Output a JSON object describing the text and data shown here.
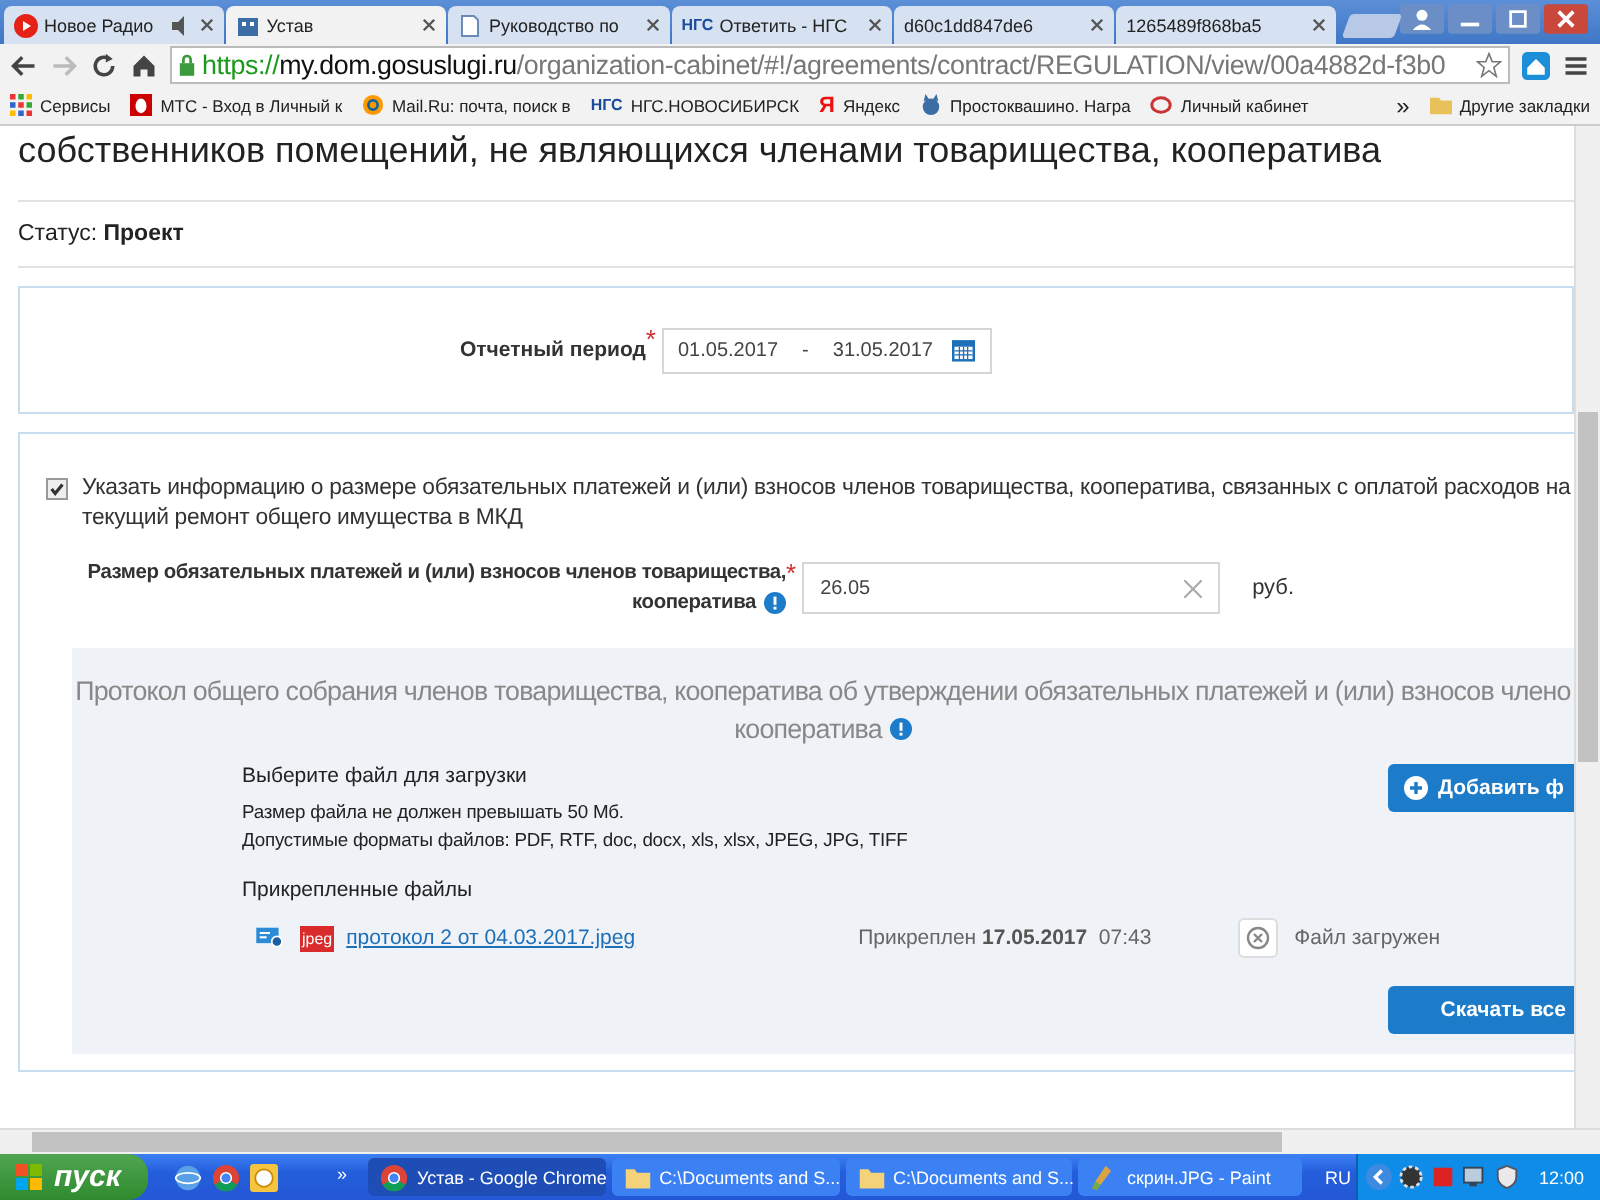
{
  "browser": {
    "tabs": [
      {
        "title": "Новое Радио",
        "kind": "play",
        "selected": false,
        "muted": true
      },
      {
        "title": "Устав",
        "kind": "building",
        "selected": true,
        "muted": false
      },
      {
        "title": "Руководство по",
        "kind": "page",
        "selected": false,
        "muted": false
      },
      {
        "title": "Ответить - НГС",
        "kind": "logo",
        "logo_text": "НГС",
        "selected": false,
        "muted": false
      },
      {
        "title": "d60c1dd847de6",
        "kind": "blank",
        "selected": false,
        "muted": false
      },
      {
        "title": "1265489f868ba5",
        "kind": "blank",
        "selected": false,
        "muted": false
      }
    ],
    "url": {
      "scheme": "https://",
      "host": "my.dom.gosuslugi.ru",
      "path": "/organization-cabinet/#!/agreements/contract/REGULATION/view/00a4882d-f3b0"
    },
    "bookmarks": [
      {
        "label": "Сервисы",
        "kind": "grid"
      },
      {
        "label": "МТС - Вход в Личный к",
        "kind": "egg"
      },
      {
        "label": "Mail.Ru: почта, поиск в",
        "kind": "at"
      },
      {
        "label": "НГС.НОВОСИБИРСК",
        "kind": "logo",
        "logo_text": "НГС"
      },
      {
        "label": "Яндекс",
        "kind": "letter",
        "logo_text": "Я"
      },
      {
        "label": "Простоквашино. Награ",
        "kind": "cat"
      },
      {
        "label": "Личный кабинет",
        "kind": "ring"
      }
    ],
    "more": "»",
    "other_bookmarks": "Другие закладки"
  },
  "page": {
    "heading": "собственников помещений, не являющихся членами товарищества, кооператива",
    "status": {
      "label": "Статус:",
      "value": "Проект"
    },
    "period": {
      "label": "Отчетный период",
      "required_mark": "*",
      "from": "01.05.2017",
      "separator": "-",
      "to": "31.05.2017"
    },
    "payments": {
      "checked": true,
      "text": "Указать информацию о размере обязательных платежей и (или) взносов членов товарищества, кооператива, связанных с оплатой расходов на текущий ремонт общего имущества в МКД",
      "amount": {
        "label_line1": "Размер обязательных платежей и (или) взносов членов товарищества,",
        "label_line2": "кооператива",
        "required_mark": "*",
        "value": "26.05",
        "unit": "руб."
      }
    },
    "protocol": {
      "title_line1": "Протокол общего собрания членов товарищества, кооператива об утверждении обязательных платежей и (или) взносов члено",
      "title_line2": "кооператива",
      "select_label": "Выберите файл для загрузки",
      "add_button": "Добавить ф",
      "size_note": "Размер файла не должен превышать 50 Мб.",
      "formats_note": "Допустимые форматы файлов: PDF, RTF, doc, docx, xls, xlsx, JPEG, JPG, TIFF",
      "attached_label": "Прикрепленные файлы",
      "files": [
        {
          "type": "jpeg",
          "name": "протокол 2 от 04.03.2017.jpeg",
          "attached": "Прикреплен",
          "date": "17.05.2017",
          "time": "07:43",
          "status": "Файл загружен"
        }
      ],
      "download_button": "Скачать все"
    }
  },
  "taskbar": {
    "start": "пуск",
    "more": "»",
    "windows": [
      {
        "title": "Устав - Google Chrome",
        "kind": "chrome",
        "selected": true
      },
      {
        "title": "C:\\Documents and S...",
        "kind": "folder",
        "selected": false
      },
      {
        "title": "C:\\Documents and S...",
        "kind": "folder",
        "selected": false
      },
      {
        "title": "скрин.JPG - Paint",
        "kind": "paint",
        "selected": false
      }
    ],
    "lang": "RU",
    "clock": "12:00"
  }
}
